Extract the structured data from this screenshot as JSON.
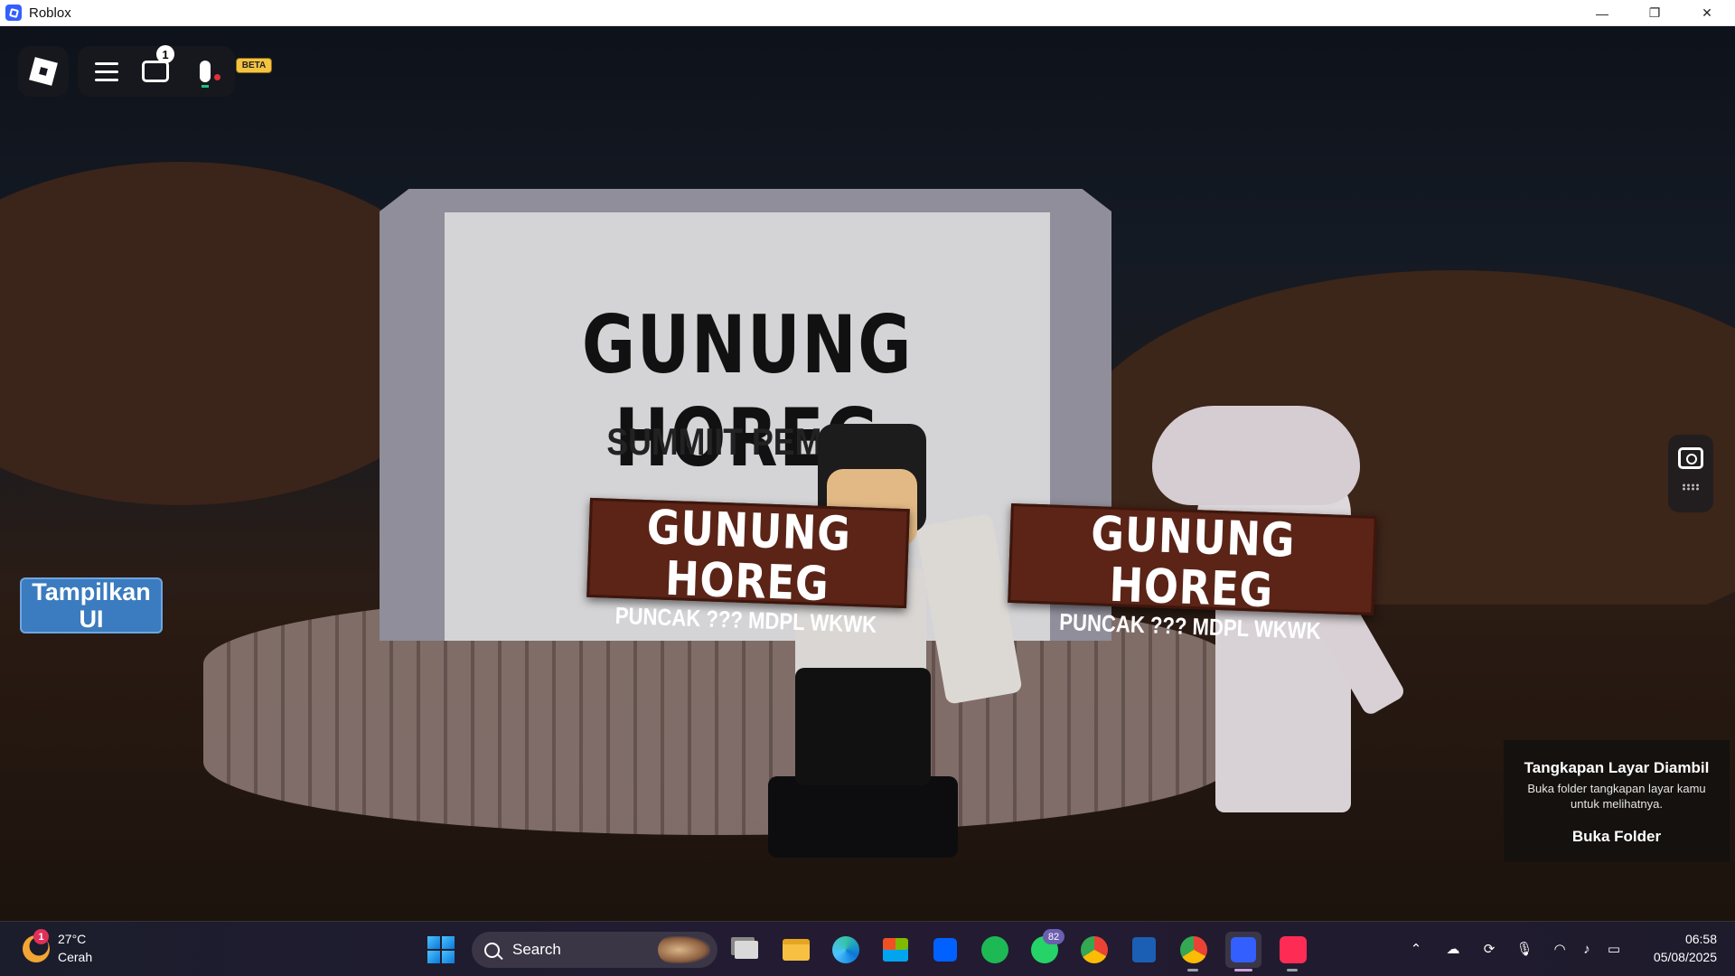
{
  "window": {
    "title": "Roblox",
    "minimize": "—",
    "maximize": "❐",
    "close": "✕"
  },
  "game": {
    "board_title": "GUNUNG HOREG",
    "board_subtitle": "SUMMIIT PEMULA",
    "sign_left": {
      "title": "GUNUNG HOREG",
      "subtitle": "PUNCAK ??? MDPL WKWK"
    },
    "sign_right": {
      "title": "GUNUNG HOREG",
      "subtitle": "PUNCAK ??? MDPL WKWK"
    }
  },
  "roblox_ui": {
    "chat_badge": "1",
    "beta_label": "BETA",
    "show_ui_button": "Tampilkan UI"
  },
  "toast": {
    "title": "Tangkapan Layar Diambil",
    "body": "Buka folder tangkapan layar kamu untuk melihatnya.",
    "action": "Buka Folder"
  },
  "taskbar": {
    "weather": {
      "badge": "1",
      "temp": "27°C",
      "condition": "Cerah"
    },
    "search_placeholder": "Search",
    "whatsapp_badge": "82",
    "apps": [
      "start-icon",
      "task-view-icon",
      "file-explorer-icon",
      "edge-icon",
      "store-icon",
      "dropbox-icon",
      "spotify-icon",
      "whatsapp-icon",
      "chrome-icon",
      "roblox-studio-icon",
      "chrome-profile-icon",
      "roblox-icon",
      "tiktok-icon"
    ],
    "clock_time": "06:58",
    "clock_date": "05/08/2025"
  },
  "colors": {
    "roblox_blue": "#335fff",
    "show_ui_bg": "#3b7bbf",
    "sign_wood": "#5b2417",
    "beta": "#f4c441"
  }
}
